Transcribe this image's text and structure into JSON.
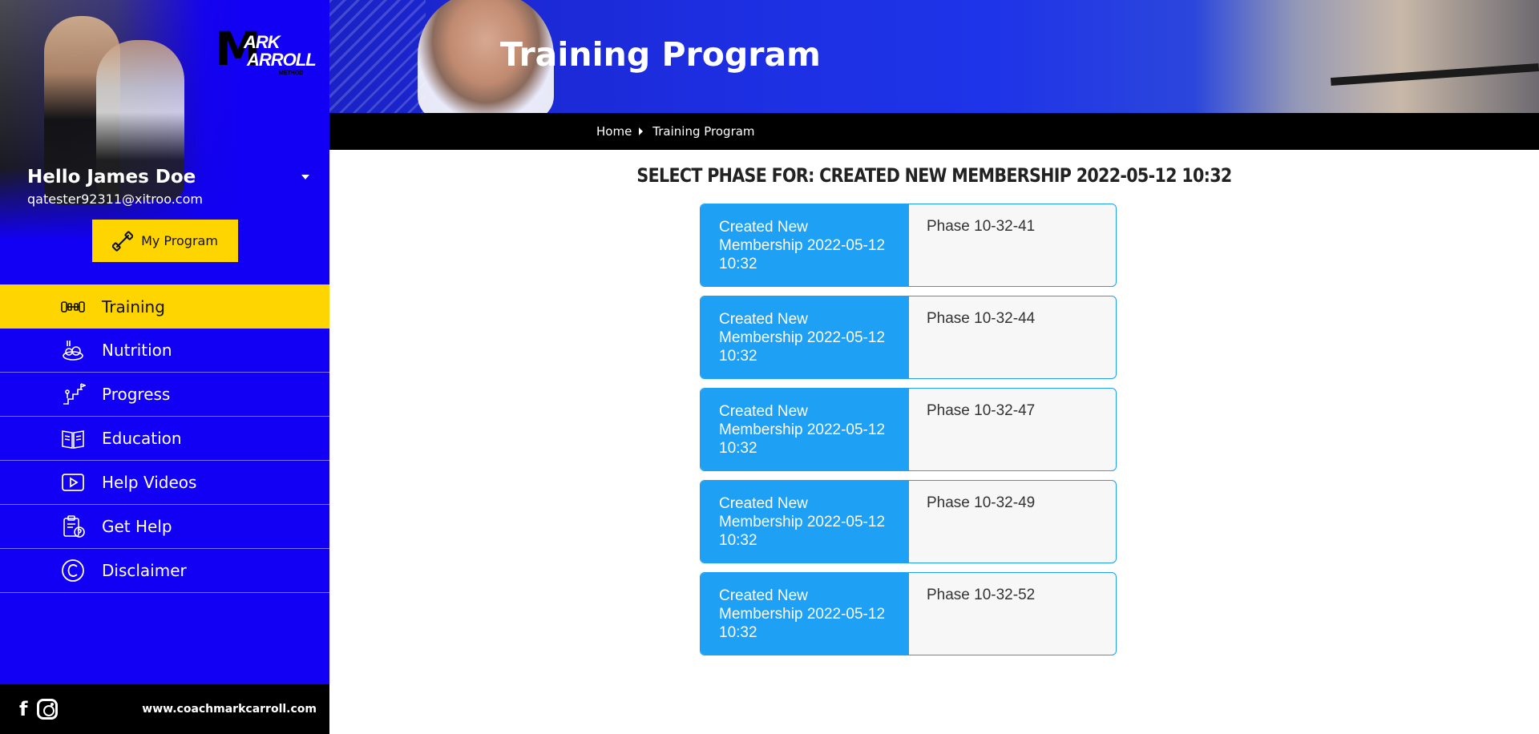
{
  "brand": {
    "logo_mark": "M",
    "logo_line1": "ARK",
    "logo_line2": "ARROLL",
    "logo_line3": "METHOD",
    "site_url": "www.coachmarkcarroll.com",
    "primary_color": "#1200f5",
    "accent_color": "#ffd500",
    "card_color": "#1ea0f5"
  },
  "user": {
    "greeting": "Hello James Doe",
    "email": "qatester92311@xitroo.com"
  },
  "sidebar": {
    "my_program_label": "My Program",
    "items": [
      {
        "label": "Training",
        "icon": "dumbbell-hands-icon",
        "active": true
      },
      {
        "label": "Nutrition",
        "icon": "food-icon"
      },
      {
        "label": "Progress",
        "icon": "progress-stairs-icon"
      },
      {
        "label": "Education",
        "icon": "book-icon"
      },
      {
        "label": "Help Videos",
        "icon": "play-icon"
      },
      {
        "label": "Get Help",
        "icon": "clipboard-help-icon"
      },
      {
        "label": "Disclaimer",
        "icon": "copyright-icon"
      }
    ]
  },
  "header": {
    "title": "Training Program",
    "breadcrumb": [
      "Home",
      "Training Program"
    ]
  },
  "main": {
    "heading": "SELECT PHASE FOR: CREATED NEW MEMBERSHIP 2022-05-12 10:32",
    "phases": [
      {
        "membership": "Created New Membership 2022-05-12 10:32",
        "phase": "Phase 10-32-41"
      },
      {
        "membership": "Created New Membership 2022-05-12 10:32",
        "phase": "Phase 10-32-44"
      },
      {
        "membership": "Created New Membership 2022-05-12 10:32",
        "phase": "Phase 10-32-47"
      },
      {
        "membership": "Created New Membership 2022-05-12 10:32",
        "phase": "Phase 10-32-49"
      },
      {
        "membership": "Created New Membership 2022-05-12 10:32",
        "phase": "Phase 10-32-52"
      }
    ]
  },
  "social": {
    "facebook_icon": "facebook-icon",
    "instagram_icon": "instagram-icon"
  }
}
